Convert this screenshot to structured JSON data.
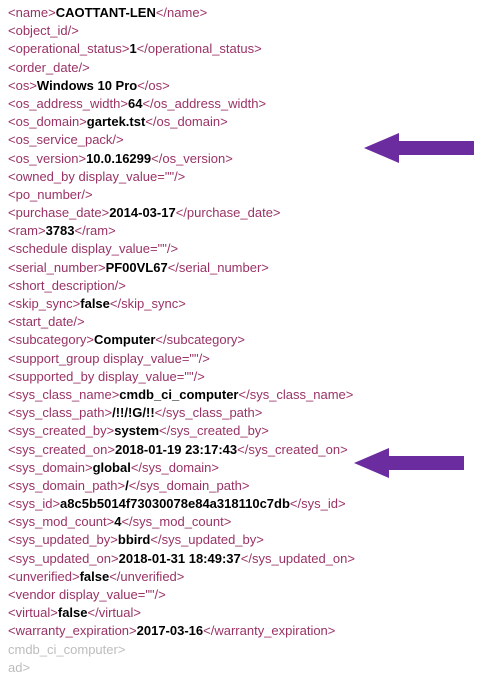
{
  "lines": [
    {
      "tag": "name",
      "val": "CAOTTANT-LEN"
    },
    {
      "tag": "object_id",
      "self": true
    },
    {
      "tag": "operational_status",
      "val": "1"
    },
    {
      "tag": "order_date",
      "self": true
    },
    {
      "tag": "os",
      "val": "Windows 10 Pro"
    },
    {
      "tag": "os_address_width",
      "val": "64"
    },
    {
      "tag": "os_domain",
      "val": "gartek.tst"
    },
    {
      "tag": "os_service_pack",
      "self": true
    },
    {
      "tag": "os_version",
      "val": "10.0.16299"
    },
    {
      "tag": "owned_by",
      "attr": "display_value",
      "attrv": "",
      "self": true
    },
    {
      "tag": "po_number",
      "self": true
    },
    {
      "tag": "purchase_date",
      "val": "2014-03-17"
    },
    {
      "tag": "ram",
      "val": "3783"
    },
    {
      "tag": "schedule",
      "attr": "display_value",
      "attrv": "",
      "self": true
    },
    {
      "tag": "serial_number",
      "val": "PF00VL67"
    },
    {
      "tag": "short_description",
      "self": true
    },
    {
      "tag": "skip_sync",
      "val": "false"
    },
    {
      "tag": "start_date",
      "self": true
    },
    {
      "tag": "subcategory",
      "val": "Computer"
    },
    {
      "tag": "support_group",
      "attr": "display_value",
      "attrv": "",
      "self": true
    },
    {
      "tag": "supported_by",
      "attr": "display_value",
      "attrv": "",
      "self": true
    },
    {
      "tag": "sys_class_name",
      "val": "cmdb_ci_computer"
    },
    {
      "tag": "sys_class_path",
      "val": "/!!/!G/!!"
    },
    {
      "tag": "sys_created_by",
      "val": "system"
    },
    {
      "tag": "sys_created_on",
      "val": "2018-01-19 23:17:43"
    },
    {
      "tag": "sys_domain",
      "val": "global"
    },
    {
      "tag": "sys_domain_path",
      "val": "/"
    },
    {
      "tag": "sys_id",
      "val": "a8c5b5014f73030078e84a318110c7db"
    },
    {
      "tag": "sys_mod_count",
      "val": "4"
    },
    {
      "tag": "sys_updated_by",
      "val": "bbird"
    },
    {
      "tag": "sys_updated_on",
      "val": "2018-01-31 18:49:37"
    },
    {
      "tag": "unverified",
      "val": "false"
    },
    {
      "tag": "vendor",
      "attr": "display_value",
      "attrv": "",
      "self": true
    },
    {
      "tag": "virtual",
      "val": "false"
    },
    {
      "tag": "warranty_expiration",
      "val": "2017-03-16"
    }
  ],
  "trailer": [
    "cmdb_ci_computer>",
    "ad>"
  ]
}
